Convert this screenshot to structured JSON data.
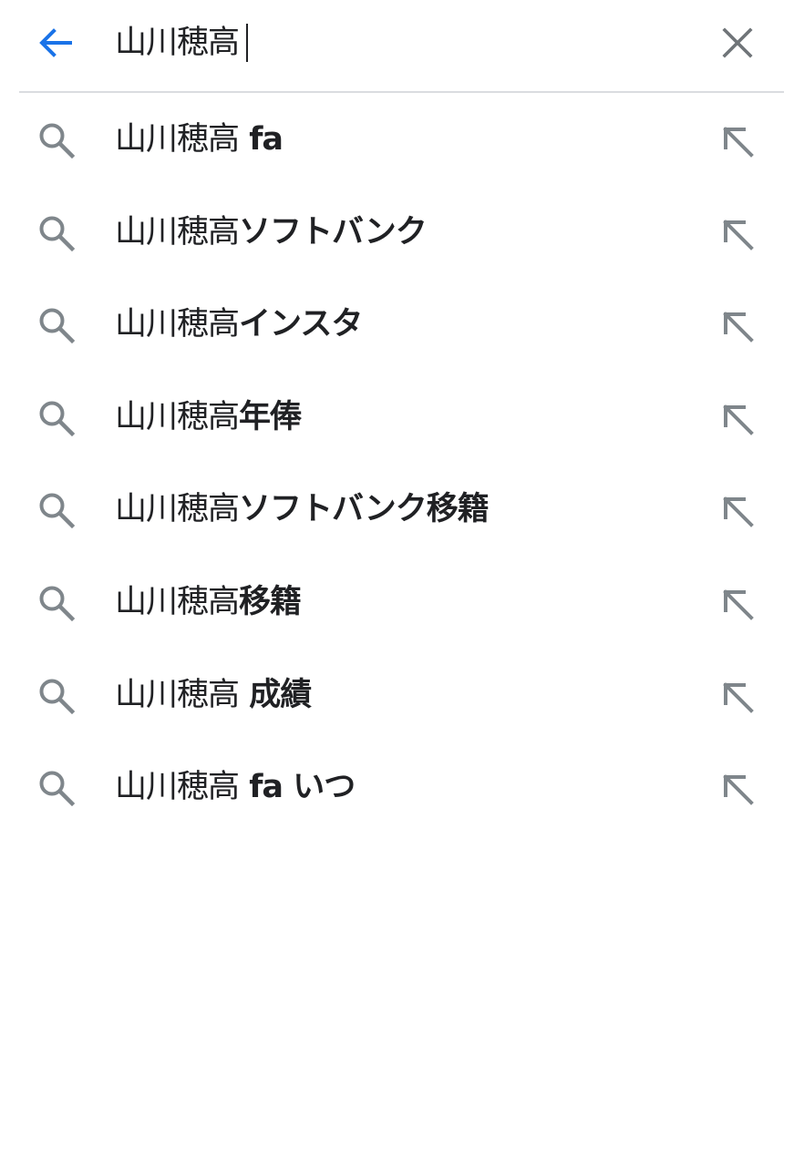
{
  "search": {
    "query": "山川穂高",
    "back_icon": "arrow-left-icon",
    "clear_icon": "close-icon"
  },
  "colors": {
    "accent": "#1a73e8",
    "icon_gray": "#7f868b",
    "text": "#202124",
    "divider": "#dadce0"
  },
  "suggestions": [
    {
      "base": "山川穂高",
      "completion": " fa"
    },
    {
      "base": "山川穂高",
      "completion": "ソフトバンク"
    },
    {
      "base": "山川穂高",
      "completion": "インスタ"
    },
    {
      "base": "山川穂高",
      "completion": "年俸"
    },
    {
      "base": "山川穂高",
      "completion": "ソフトバンク移籍"
    },
    {
      "base": "山川穂高",
      "completion": "移籍"
    },
    {
      "base": "山川穂高",
      "completion": " 成績"
    },
    {
      "base": "山川穂高",
      "completion": " fa いつ"
    }
  ]
}
